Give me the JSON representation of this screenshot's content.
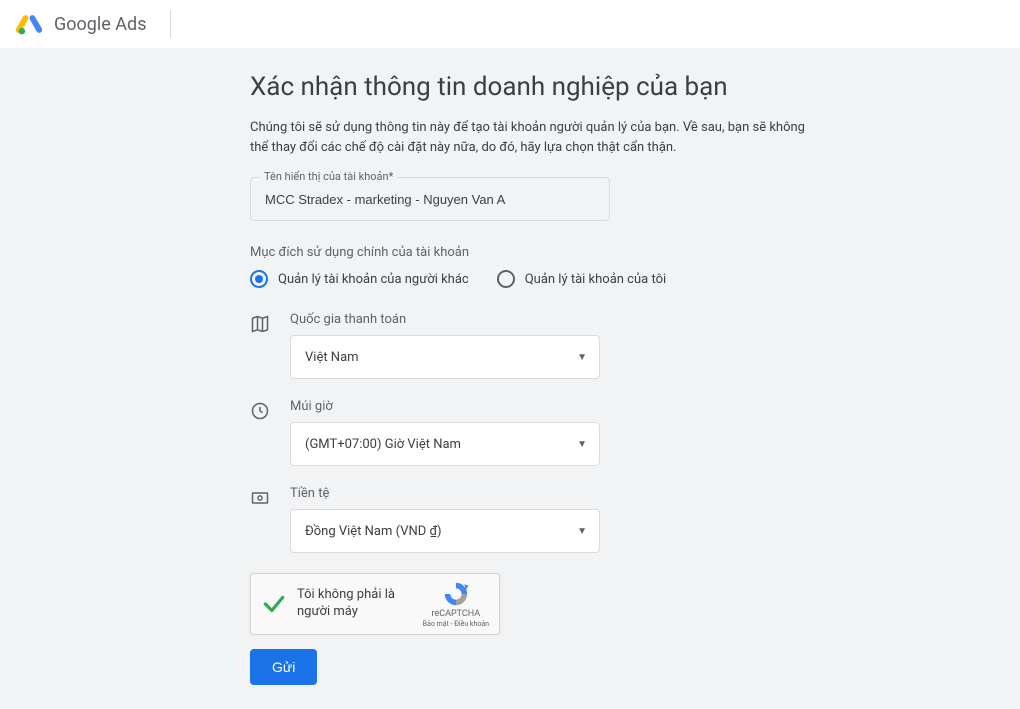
{
  "header": {
    "product": "Google",
    "product_suffix": "Ads"
  },
  "page": {
    "title": "Xác nhận thông tin doanh nghiệp của bạn",
    "description": "Chúng tôi sẽ sử dụng thông tin này để tạo tài khoản người quản lý của bạn. Về sau, bạn sẽ không thể thay đổi các chế độ cài đặt này nữa, do đó, hãy lựa chọn thật cẩn thận."
  },
  "account_name": {
    "label": "Tên hiển thị của tài khoản*",
    "value": "MCC Stradex - marketing - Nguyen Van A"
  },
  "usage": {
    "label": "Mục đích sử dụng chính của tài khoản",
    "option_manage_others": "Quản lý tài khoản của người khác",
    "option_manage_mine": "Quản lý tài khoản của tôi"
  },
  "country": {
    "label": "Quốc gia thanh toán",
    "value": "Việt Nam"
  },
  "timezone": {
    "label": "Múi giờ",
    "value": "(GMT+07:00) Giờ Việt Nam"
  },
  "currency": {
    "label": "Tiền tệ",
    "value": "Đồng Việt Nam (VND ₫)"
  },
  "captcha": {
    "text": "Tôi không phải là người máy",
    "brand": "reCAPTCHA",
    "terms": "Bảo mật - Điều khoản"
  },
  "submit": "Gửi"
}
